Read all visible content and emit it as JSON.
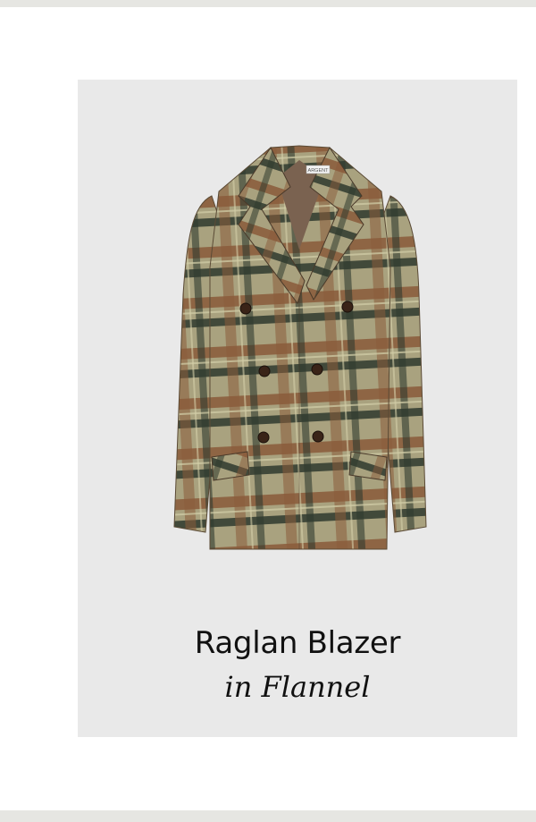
{
  "product": {
    "name": "Raglan Blazer",
    "material": "in Flannel",
    "label_tag": "ARGENT",
    "image_icon": "plaid-blazer-image"
  },
  "colors": {
    "page_background": "#ffffff",
    "card_background": "#e9e9e9",
    "band": "#e6e6e2",
    "plaid_base": "#a9a27f",
    "plaid_brown": "#8a5a3a",
    "plaid_green": "#2f3a2e"
  }
}
